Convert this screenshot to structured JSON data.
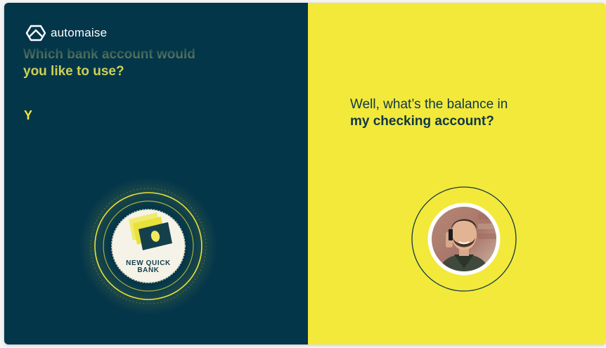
{
  "brand": {
    "name": "automaise",
    "icon": "automaise-logo-icon"
  },
  "left_panel": {
    "question_line1": "Which bank account would",
    "question_line2": "you like to use?",
    "typed_text": "Y",
    "bank_logo": {
      "line1": "NEW QUICK",
      "line2": "BANK",
      "icon": "banknote-card-icon"
    }
  },
  "right_panel": {
    "answer_line1": "Well, what’s the balance in",
    "answer_line2": "my checking account?",
    "avatar": "user-avatar-man-on-phone"
  },
  "colors": {
    "left_background": "#04364a",
    "right_background": "#f2e93b",
    "accent_yellow": "#f2e93b",
    "text_dark": "#113746"
  }
}
